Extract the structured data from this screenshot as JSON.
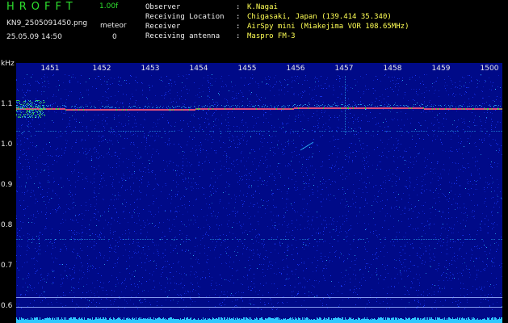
{
  "header": {
    "app_title": "HROFFT",
    "version": "1.00f",
    "filename": "KN9_2505091450.png",
    "timestamp": "25.05.09 14:50",
    "meteor_label": "meteor",
    "meteor_count": "0"
  },
  "info": [
    {
      "key": "Observer",
      "sep": ":",
      "value": "K.Nagai"
    },
    {
      "key": "Receiving Location",
      "sep": ":",
      "value": "Chigasaki, Japan (139.414 35.340)"
    },
    {
      "key": "Receiver",
      "sep": ":",
      "value": "AirSpy mini (Miakejima VOR 108.65MHz)"
    },
    {
      "key": "Receiving antenna",
      "sep": ":",
      "value": "Maspro FM-3"
    }
  ],
  "spectrogram": {
    "unit": "kHz",
    "time_labels": [
      "1451",
      "1452",
      "1453",
      "1454",
      "1455",
      "1456",
      "1457",
      "1458",
      "1459",
      "1500"
    ],
    "freq_labels": [
      "1.1",
      "1.0",
      "0.9",
      "0.8",
      "0.7",
      "0.6"
    ],
    "colors": {
      "background": "#000a88",
      "noise_low": "#1a3cff",
      "noise_high": "#31c4ff",
      "carrier": "#ff5a7a",
      "carrier_hot": "#49ff3a",
      "bottom_band": "#2fc8ff"
    }
  }
}
